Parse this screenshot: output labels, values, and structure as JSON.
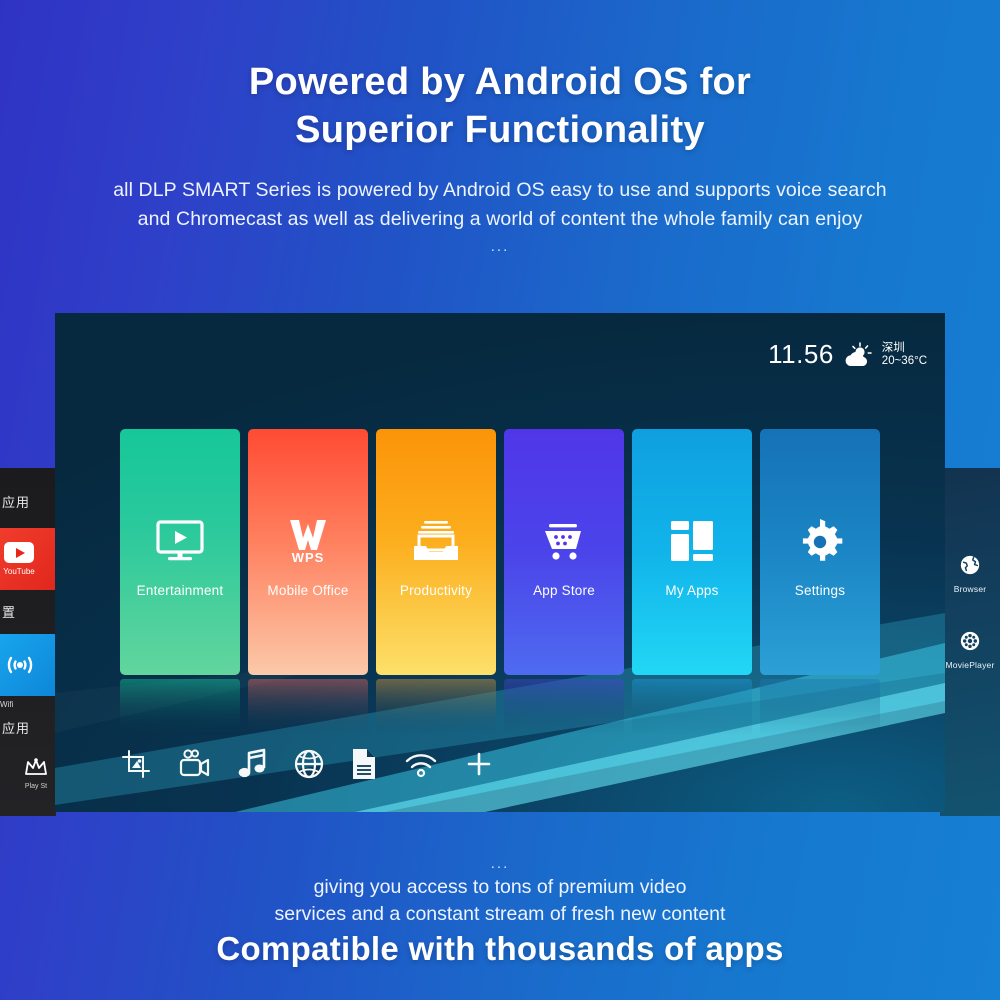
{
  "headline": {
    "line1": "Powered by Android OS for",
    "line2": "Superior Functionality"
  },
  "subcopy": {
    "line1": "all DLP SMART Series is powered by Android OS easy to use and supports voice search",
    "line2": "and Chromecast as well as delivering a world of content the whole family can enjoy",
    "ellipsis": "..."
  },
  "tv": {
    "status": {
      "time": "11.56",
      "weather_icon": "sun-behind-cloud-icon",
      "city": "深圳",
      "temperature": "20~36°C"
    },
    "tiles": [
      {
        "label": "Entertainment",
        "icon": "tv-play-icon",
        "color": "#16c79a"
      },
      {
        "label": "Mobile Office",
        "icon": "wps-logo-icon",
        "color": "#ff4b33"
      },
      {
        "label": "Productivity",
        "icon": "file-tray-icon",
        "color": "#fb9409"
      },
      {
        "label": "App Store",
        "icon": "shopping-cart-icon",
        "color": "#5036e8"
      },
      {
        "label": "My Apps",
        "icon": "app-grid-icon",
        "color": "#0f9fe0"
      },
      {
        "label": "Settings",
        "icon": "gear-icon",
        "color": "#1572b6"
      }
    ],
    "dock": [
      {
        "name": "image-crop-icon"
      },
      {
        "name": "video-camera-icon"
      },
      {
        "name": "music-note-icon"
      },
      {
        "name": "globe-icon"
      },
      {
        "name": "document-icon"
      },
      {
        "name": "wifi-icon"
      },
      {
        "name": "plus-icon"
      }
    ]
  },
  "side_left": {
    "label_apps_top": "应用",
    "youtube_label": "YouTube",
    "label_settings": "置",
    "wifi_label": "Wifi",
    "label_apps_bottom": "应用",
    "playstore_label": "Play St"
  },
  "side_right": {
    "items": [
      {
        "label": "Browser",
        "icon": "globe-icon"
      },
      {
        "label": "MoviePlayer",
        "icon": "film-reel-icon"
      }
    ]
  },
  "bottom": {
    "ellipsis": "...",
    "line1": "giving you access to tons of premium video",
    "line2": "services and a constant stream of fresh new content",
    "big": "Compatible with thousands of apps"
  },
  "colors": {
    "bg_left": "#2f33c4",
    "bg_right": "#1680d4",
    "tv_bg": "#0a2f4d",
    "accent_cyan": "#2ad7f5"
  }
}
